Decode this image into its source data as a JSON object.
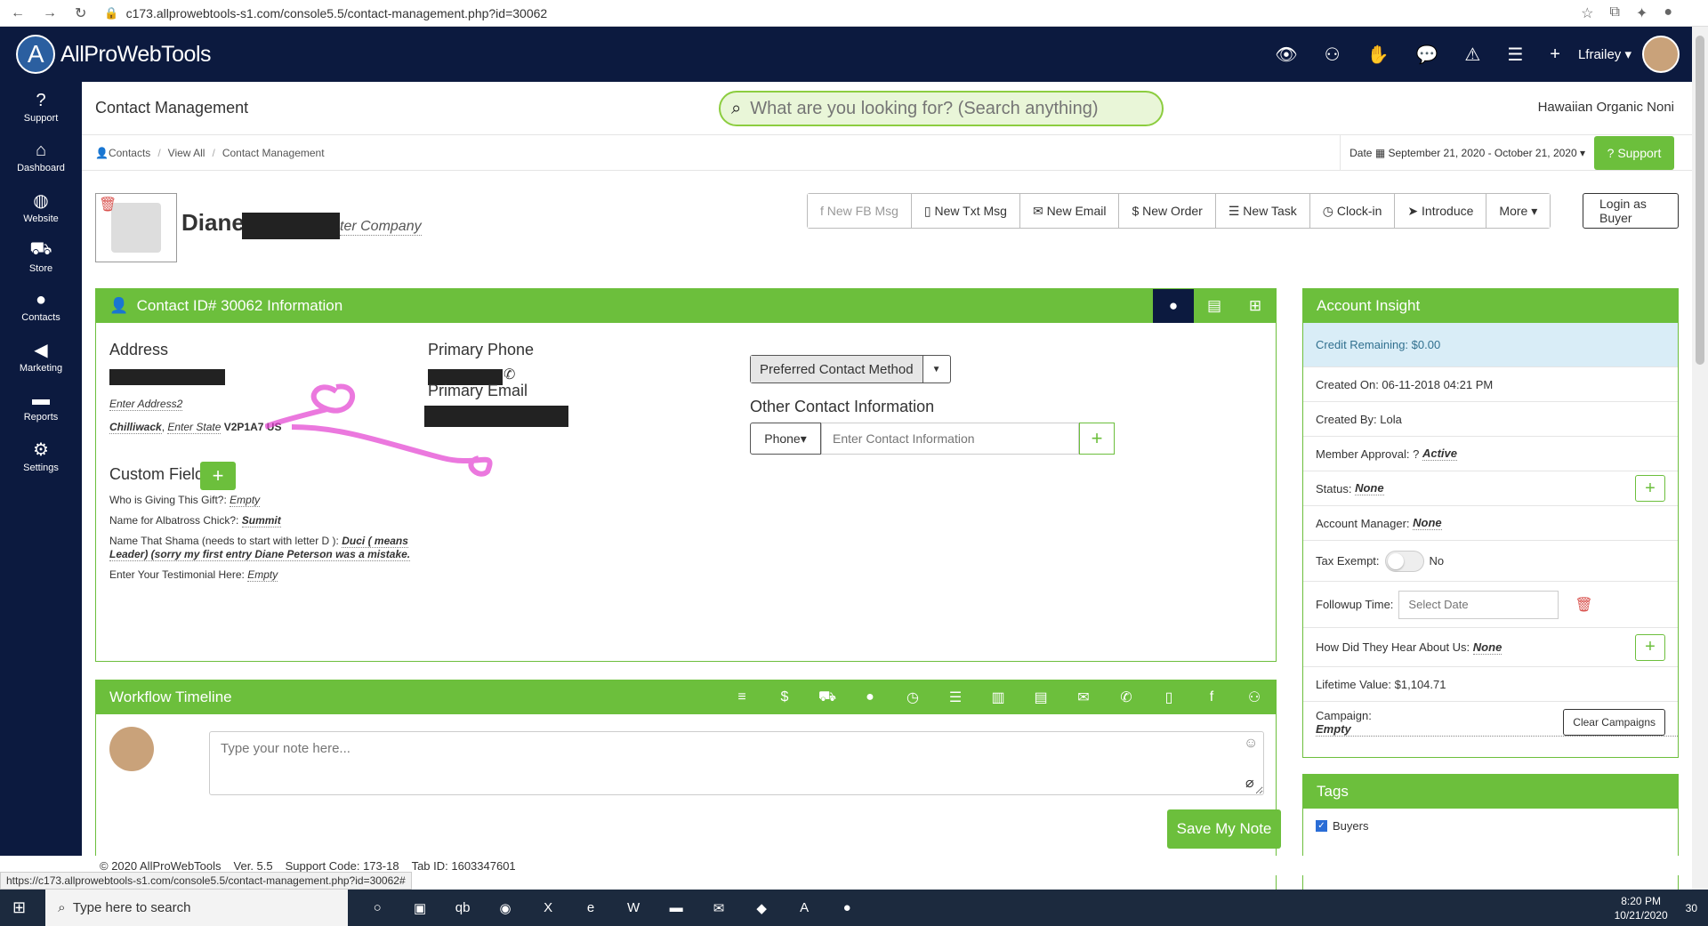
{
  "browser": {
    "url": "c173.allprowebtools-s1.com/console5.5/contact-management.php?id=30062"
  },
  "topbar": {
    "brand": "AllProWebTools",
    "user": "Lfrailey"
  },
  "sidebar": {
    "items": [
      {
        "label": "Support",
        "icon": "question-icon"
      },
      {
        "label": "Dashboard",
        "icon": "home-icon"
      },
      {
        "label": "Website",
        "icon": "globe-icon"
      },
      {
        "label": "Store",
        "icon": "cart-icon"
      },
      {
        "label": "Contacts",
        "icon": "person-icon"
      },
      {
        "label": "Marketing",
        "icon": "megaphone-icon"
      },
      {
        "label": "Reports",
        "icon": "folder-icon"
      },
      {
        "label": "Settings",
        "icon": "gear-icon"
      }
    ]
  },
  "header": {
    "title": "Contact Management",
    "search_placeholder": "What are you looking for? (Search anything)",
    "business": "Hawaiian Organic Noni"
  },
  "breadcrumb": {
    "items": [
      "Contacts",
      "View All",
      "Contact Management"
    ],
    "date_label": "Date",
    "date_range": "September 21, 2020 - October 21, 2020",
    "support": "Support"
  },
  "contact": {
    "first_name": "Diane",
    "company_placeholder": "ter Company",
    "login_as_buyer": "Login as Buyer"
  },
  "actions": [
    "New FB Msg",
    "New Txt Msg",
    "New Email",
    "New Order",
    "New Task",
    "Clock-in",
    "Introduce",
    "More"
  ],
  "info": {
    "title": "Contact ID# 30062 Information",
    "address_label": "Address",
    "address2_placeholder": "Enter Address2",
    "city": "Chilliwack",
    "state_placeholder": "Enter State",
    "postal": "V2P1A7",
    "country": "US",
    "primary_phone_label": "Primary Phone",
    "primary_email_label": "Primary Email",
    "preferred_method": "Preferred Contact Method",
    "other_contact_label": "Other Contact Information",
    "phone_select": "Phone",
    "contact_info_placeholder": "Enter Contact Information",
    "custom_fields_label": "Custom Fields",
    "fields": [
      {
        "label": "Who is Giving This Gift?:",
        "value": "Empty"
      },
      {
        "label": "Name for Albatross Chick?:",
        "value": "Summit"
      },
      {
        "label": "Name That Shama (needs to start with letter D ):",
        "value": "Duci ( means Leader) (sorry my first entry Diane Peterson was a mistake."
      },
      {
        "label": "Enter Your Testimonial Here:",
        "value": "Empty"
      }
    ]
  },
  "workflow": {
    "title": "Workflow Timeline",
    "note_placeholder": "Type your note here...",
    "save": "Save My Note"
  },
  "insight": {
    "title": "Account Insight",
    "credit": "Credit Remaining: $0.00",
    "created_on": "Created On: 06-11-2018 04:21 PM",
    "created_by": "Created By: Lola",
    "member_approval_label": "Member Approval:",
    "member_approval_value": "Active",
    "status_label": "Status:",
    "status_value": "None",
    "account_manager_label": "Account Manager:",
    "account_manager_value": "None",
    "tax_exempt_label": "Tax Exempt:",
    "tax_exempt_value": "No",
    "followup_label": "Followup Time:",
    "followup_placeholder": "Select Date",
    "hear_label": "How Did They Hear About Us:",
    "hear_value": "None",
    "lifetime": "Lifetime Value: $1,104.71",
    "campaign_label": "Campaign:",
    "campaign_value": "Empty",
    "clear_campaigns": "Clear Campaigns"
  },
  "tags": {
    "title": "Tags",
    "items": [
      "Buyers"
    ]
  },
  "footer": {
    "left": "© 2020 AllProWebTools",
    "version": "Ver. 5.5",
    "support_code": "Support Code: 173-18",
    "tab_id": "Tab ID: 1603347601",
    "status_url": "https://c173.allprowebtools-s1.com/console5.5/contact-management.php?id=30062#"
  },
  "taskbar": {
    "search": "Type here to search",
    "time": "8:20 PM",
    "date": "10/21/2020",
    "notifications": "30"
  },
  "colors": {
    "navy": "#0c1a3f",
    "green": "#6cbf3c"
  }
}
